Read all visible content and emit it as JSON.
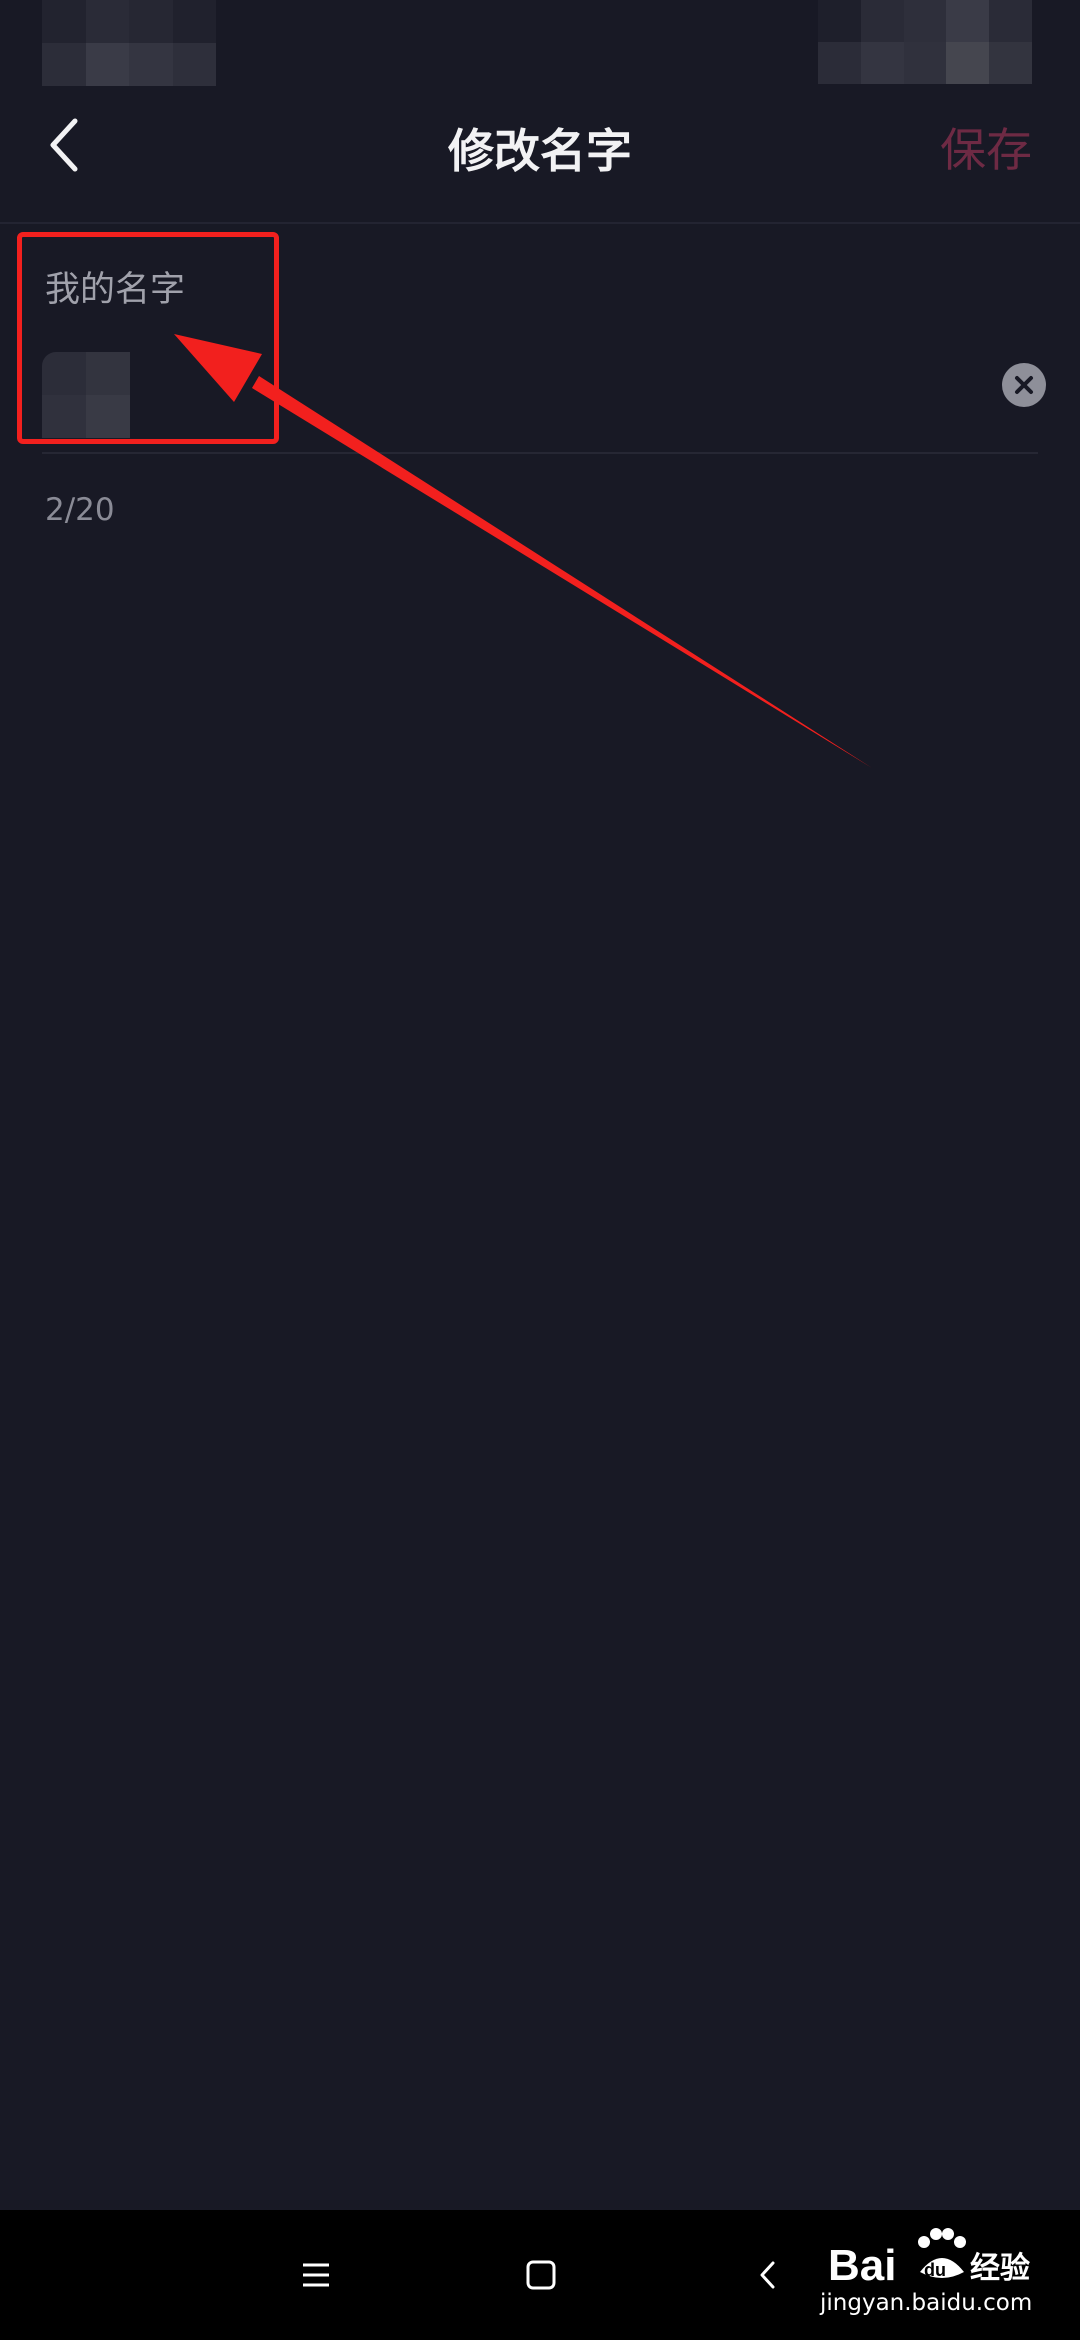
{
  "header": {
    "title": "修改名字",
    "save_label": "保存"
  },
  "field": {
    "label": "我的名字",
    "value": "",
    "char_count": "2/20"
  },
  "watermark": {
    "text": "Baidu经验",
    "url": "jingyan.baidu.com"
  },
  "colors": {
    "background": "#181925",
    "title": "#f2f2f4",
    "save_disabled": "#6e2a44",
    "annotation_red": "#f2201e"
  }
}
